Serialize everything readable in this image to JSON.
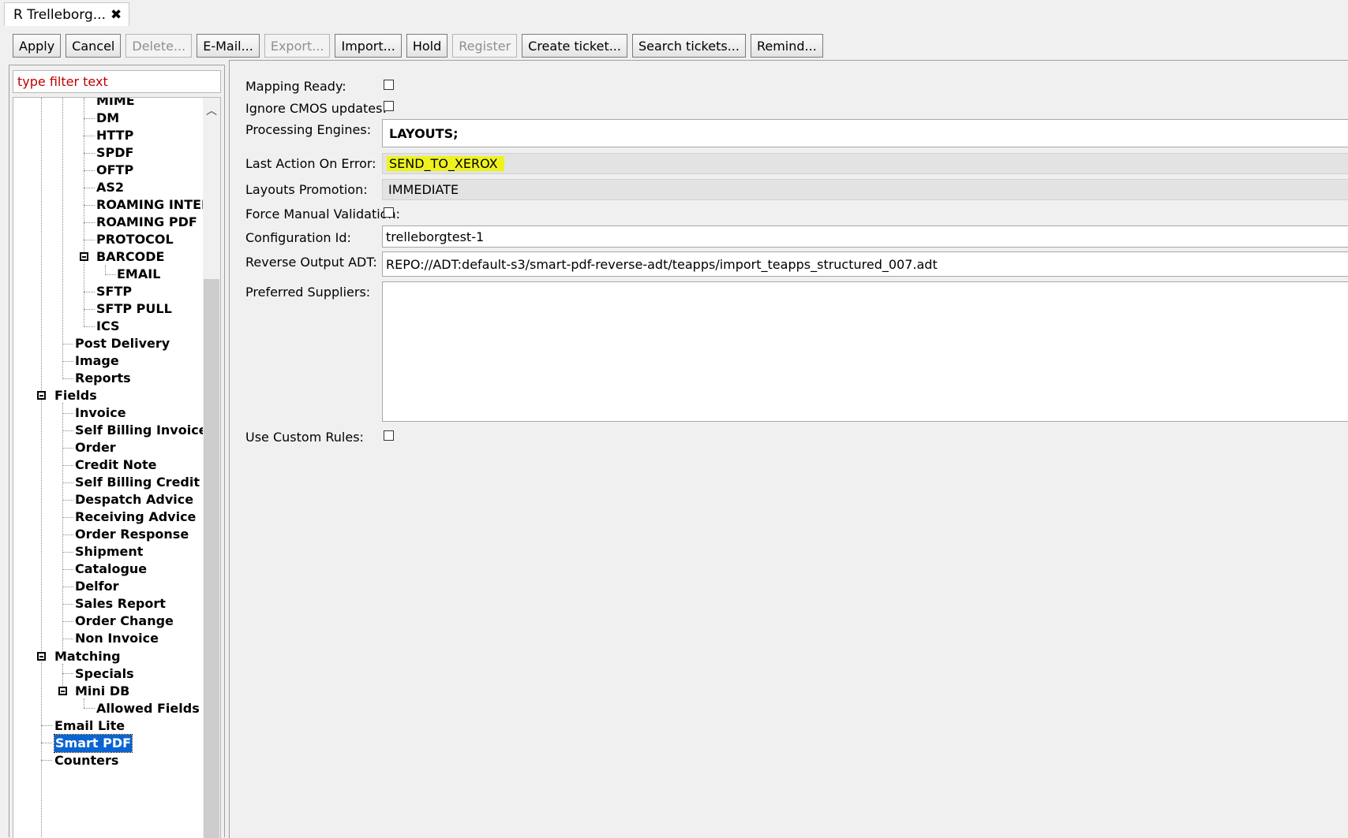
{
  "tab": {
    "title": "R Trelleborg...",
    "close": "✖"
  },
  "toolbar": {
    "apply": "Apply",
    "cancel": "Cancel",
    "delete": "Delete...",
    "email": "E-Mail...",
    "export": "Export...",
    "import": "Import...",
    "hold": "Hold",
    "register": "Register",
    "create_ticket": "Create ticket...",
    "search_tickets": "Search tickets...",
    "remind": "Remind..."
  },
  "filter": {
    "placeholder": "type filter text"
  },
  "tree": {
    "mime": "MIME",
    "dm": "DM",
    "http": "HTTP",
    "spdf": "SPDF",
    "oftp": "OFTP",
    "as2": "AS2",
    "roaming_inter": "ROAMING INTERI",
    "roaming_pdf": "ROAMING PDF",
    "protocol": "PROTOCOL",
    "barcode": "BARCODE",
    "email": "EMAIL",
    "sftp": "SFTP",
    "sftp_pull": "SFTP PULL",
    "ics": "ICS",
    "post_delivery": "Post Delivery",
    "image": "Image",
    "reports": "Reports",
    "fields": "Fields",
    "invoice": "Invoice",
    "self_billing_invoice": "Self Billing Invoice",
    "order": "Order",
    "credit_note": "Credit Note",
    "self_billing_credit": "Self Billing Credit No",
    "despatch_advice": "Despatch Advice",
    "receiving_advice": "Receiving Advice",
    "order_response": "Order Response",
    "shipment": "Shipment",
    "catalogue": "Catalogue",
    "delfor": "Delfor",
    "sales_report": "Sales Report",
    "order_change": "Order Change",
    "non_invoice": "Non Invoice",
    "matching": "Matching",
    "specials": "Specials",
    "mini_db": "Mini DB",
    "allowed_fields": "Allowed Fields",
    "email_lite": "Email Lite",
    "smart_pdf": "Smart PDF",
    "counters": "Counters"
  },
  "form": {
    "mapping_ready": {
      "label": "Mapping Ready:",
      "checked": false
    },
    "ignore_cmos": {
      "label": "Ignore CMOS updates:",
      "checked": false
    },
    "processing_engines": {
      "label": "Processing Engines:",
      "value": "LAYOUTS;"
    },
    "last_action": {
      "label": "Last Action On Error:",
      "value": "SEND_TO_XEROX"
    },
    "layouts_promotion": {
      "label": "Layouts Promotion:",
      "value": "IMMEDIATE"
    },
    "force_manual": {
      "label": "Force Manual Validation:",
      "checked": false
    },
    "configuration_id": {
      "label": "Configuration Id:",
      "value": "trelleborgtest-1"
    },
    "reverse_output": {
      "label": "Reverse Output ADT:",
      "value": "REPO://ADT:default-s3/smart-pdf-reverse-adt/teapps/import_teapps_structured_007.adt"
    },
    "preferred_suppliers": {
      "label": "Preferred Suppliers:",
      "value": ""
    },
    "use_custom_rules": {
      "label": "Use Custom Rules:",
      "checked": false
    }
  },
  "colors": {
    "highlight": "#eef320",
    "selection": "#0a64d2",
    "filter_text": "#c00000"
  }
}
